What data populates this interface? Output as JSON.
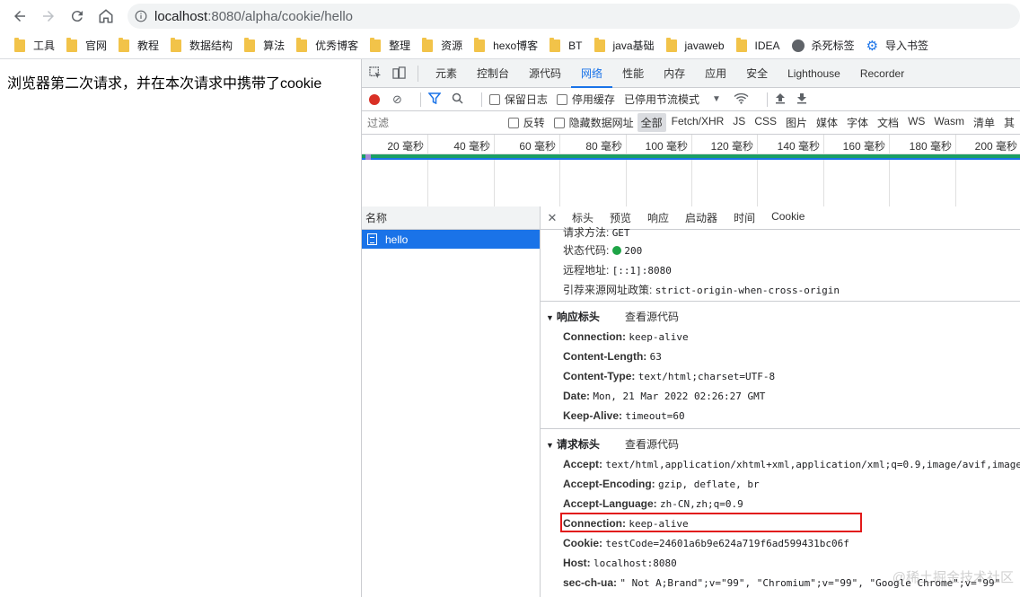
{
  "browser": {
    "url_host": "localhost",
    "url_path": ":8080/alpha/cookie/hello"
  },
  "bookmarks": [
    {
      "label": "工具",
      "icon": "folder-icon"
    },
    {
      "label": "官网",
      "icon": "folder-icon"
    },
    {
      "label": "教程",
      "icon": "folder-icon"
    },
    {
      "label": "数据结构",
      "icon": "folder-icon"
    },
    {
      "label": "算法",
      "icon": "folder-icon"
    },
    {
      "label": "优秀博客",
      "icon": "folder-icon"
    },
    {
      "label": "整理",
      "icon": "folder-icon"
    },
    {
      "label": "资源",
      "icon": "folder-icon"
    },
    {
      "label": "hexo博客",
      "icon": "folder-icon"
    },
    {
      "label": "BT",
      "icon": "folder-icon"
    },
    {
      "label": "java基础",
      "icon": "folder-icon"
    },
    {
      "label": "javaweb",
      "icon": "folder-icon"
    },
    {
      "label": "IDEA",
      "icon": "folder-icon"
    },
    {
      "label": "杀死标签",
      "icon": "globe-icon"
    },
    {
      "label": "导入书签",
      "icon": "gear-icon"
    }
  ],
  "page": {
    "text": "浏览器第二次请求，并在本次请求中携带了cookie"
  },
  "devtools": {
    "tabs": [
      "元素",
      "控制台",
      "源代码",
      "网络",
      "性能",
      "内存",
      "应用",
      "安全",
      "Lighthouse",
      "Recorder"
    ],
    "active_tab": "网络",
    "network_toolbar": {
      "preserve_log": "保留日志",
      "disable_cache": "停用缓存",
      "throttling": "已停用节流模式"
    },
    "filter": {
      "placeholder": "过滤",
      "invert": "反转",
      "hide_data_urls": "隐藏数据网址",
      "types": [
        "全部",
        "Fetch/XHR",
        "JS",
        "CSS",
        "图片",
        "媒体",
        "字体",
        "文档",
        "WS",
        "Wasm",
        "清单",
        "其"
      ]
    },
    "timeline_ticks": [
      "20 毫秒",
      "40 毫秒",
      "60 毫秒",
      "80 毫秒",
      "100 毫秒",
      "120 毫秒",
      "140 毫秒",
      "160 毫秒",
      "180 毫秒",
      "200 毫秒"
    ],
    "name_header": "名称",
    "request_name": "hello",
    "detail_tabs": [
      "标头",
      "预览",
      "响应",
      "启动器",
      "时间",
      "Cookie"
    ],
    "general": {
      "method_key": "请求方法:",
      "method_val": "GET",
      "status_key": "状态代码:",
      "status_val": "200",
      "remote_key": "远程地址:",
      "remote_val": "[::1]:8080",
      "referrer_key": "引荐来源网址政策:",
      "referrer_val": "strict-origin-when-cross-origin"
    },
    "response_headers": {
      "title": "响应标头",
      "view_source": "查看源代码",
      "items": [
        {
          "k": "Connection:",
          "v": "keep-alive"
        },
        {
          "k": "Content-Length:",
          "v": "63"
        },
        {
          "k": "Content-Type:",
          "v": "text/html;charset=UTF-8"
        },
        {
          "k": "Date:",
          "v": "Mon, 21 Mar 2022 02:26:27 GMT"
        },
        {
          "k": "Keep-Alive:",
          "v": "timeout=60"
        }
      ]
    },
    "request_headers": {
      "title": "请求标头",
      "view_source": "查看源代码",
      "items": [
        {
          "k": "Accept:",
          "v": "text/html,application/xhtml+xml,application/xml;q=0.9,image/avif,image"
        },
        {
          "k": "Accept-Encoding:",
          "v": "gzip, deflate, br"
        },
        {
          "k": "Accept-Language:",
          "v": "zh-CN,zh;q=0.9"
        },
        {
          "k": "Connection:",
          "v": "keep-alive"
        },
        {
          "k": "Cookie:",
          "v": "testCode=24601a6b9e624a719f6ad599431bc06f"
        },
        {
          "k": "Host:",
          "v": "localhost:8080"
        },
        {
          "k": "sec-ch-ua:",
          "v": "\" Not A;Brand\";v=\"99\", \"Chromium\";v=\"99\", \"Google Chrome\";v=\"99\""
        }
      ]
    }
  },
  "watermark": "@稀土掘金技术社区",
  "colors": {
    "accent": "#1a73e8",
    "status_ok": "#1ea446",
    "highlight": "#e21a1a",
    "record": "#d93025"
  }
}
